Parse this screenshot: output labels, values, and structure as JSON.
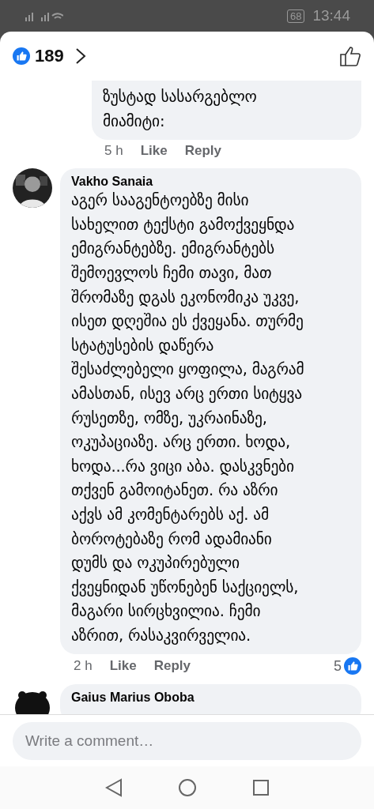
{
  "status_bar": {
    "battery": "68",
    "time": "13:44"
  },
  "header": {
    "reaction_count": "189"
  },
  "comments": [
    {
      "kind": "partial",
      "text": "ზუსტად სასარგებლო\nმიამიტი:",
      "time": "5 h",
      "like": "Like",
      "reply": "Reply"
    },
    {
      "kind": "full",
      "author": "Vakho Sanaia",
      "text": "აგერ სააგენტოებზე მისი\nსახელით ტექსტი გამოქვეყნდა\nემიგრანტებზე. ემიგრანტებს\nშემოევლოს ჩემი თავი, მათ\nშრომაზე დგას ეკონომიკა უკვე,\nისეთ დღეშია ეს ქვეყანა. თურმე\nსტატუსების დაწერა\nშესაძლებელი ყოფილა, მაგრამ\nამასთან, ისევ არც ერთი სიტყვა\nრუსეთზე, ომზე, უკრაინაზე,\nოკუპაციაზე. არც ერთი. ხოდა,\nხოდა...რა ვიცი აბა. დასკვნები\nთქვენ გამოიტანეთ. რა აზრი\nაქვს ამ კომენტარებს აქ. ამ\nბოროტებაზე რომ ადამიანი\nდუმს და ოკუპირებული\nქვეყნიდან უწონებენ საქციელს,\nმაგარი სირცხვილია. ჩემი\nაზრით, რასაკვირველია.",
      "time": "2 h",
      "like": "Like",
      "reply": "Reply",
      "reactions": "5"
    },
    {
      "kind": "cut",
      "author": "Gaius Marius Oboba"
    }
  ],
  "composer": {
    "placeholder": "Write a comment…"
  }
}
